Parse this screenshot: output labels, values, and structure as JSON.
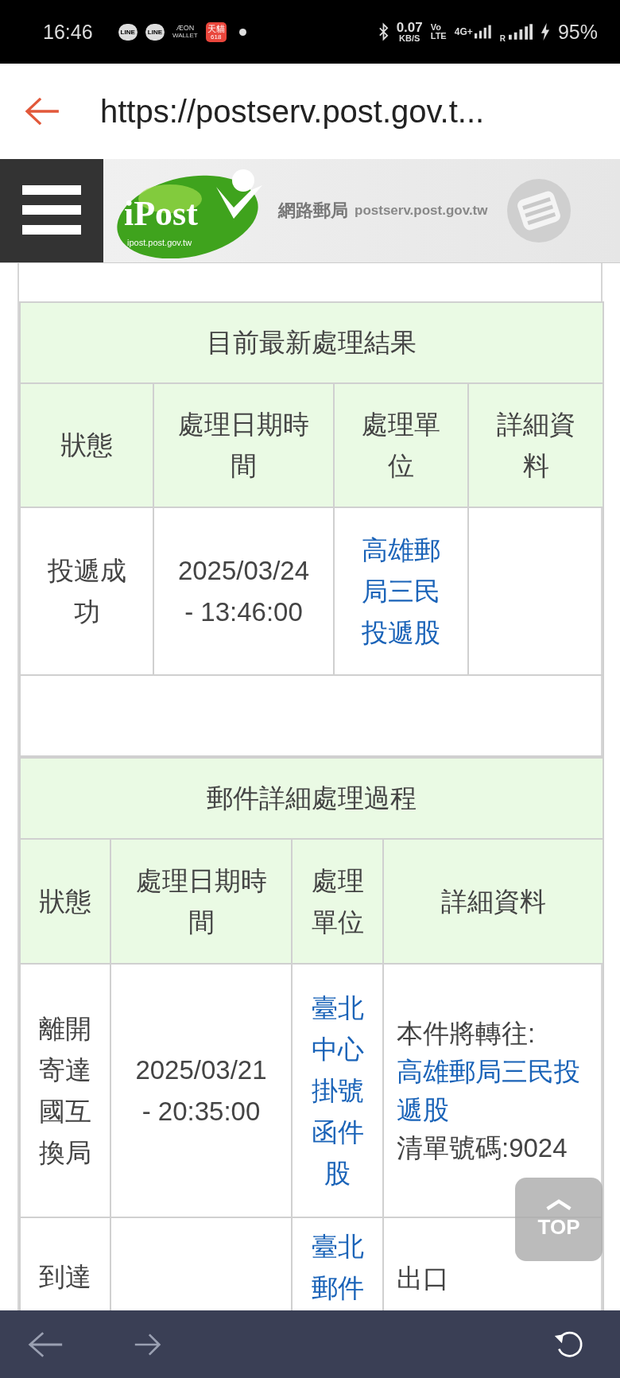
{
  "status_bar": {
    "time": "16:46",
    "app_icons": [
      {
        "kind": "bubble",
        "label": "LINE"
      },
      {
        "kind": "bubble",
        "label": "LINE"
      },
      {
        "kind": "wallet",
        "label": "ÆON",
        "sub": "WALLET"
      },
      {
        "kind": "shop",
        "label": "天貓",
        "sub": "618"
      }
    ],
    "speed": "0.07",
    "speed_unit": "KB/S",
    "volte_top": "Vo",
    "volte_bottom": "LTE",
    "network": "4G+",
    "roaming": "R",
    "battery": "95%"
  },
  "url_bar": {
    "url": "https://postserv.post.gov.t..."
  },
  "site_header": {
    "logo_text": "iPost",
    "logo_domain": "ipost.post.gov.tw",
    "site_name": "網路郵局",
    "site_domain": "postserv.post.gov.tw"
  },
  "latest": {
    "title": "目前最新處理結果",
    "columns": [
      "狀態",
      "處理日期時間",
      "處理單位",
      "詳細資料"
    ],
    "rows": [
      {
        "status": "投遞成功",
        "date": "2025/03/24",
        "time": "- 13:46:00",
        "unit": "高雄郵局三民投遞股"
      }
    ]
  },
  "history": {
    "title": "郵件詳細處理過程",
    "columns": [
      "狀態",
      "處理日期時間",
      "處理單位",
      "詳細資料"
    ],
    "rows": [
      {
        "status": "離開寄達國互換局",
        "date": "2025/03/21",
        "time": "- 20:35:00",
        "unit": "臺北中心掛號函件股",
        "detail_prefix": "本件將轉往:",
        "detail_link": "高雄郵局三民投遞股",
        "detail_note": "清單號碼:9024"
      },
      {
        "status": "到達",
        "unit": "臺北郵件",
        "detail_prefix": "出口"
      }
    ]
  },
  "top_button": {
    "label": "TOP"
  }
}
